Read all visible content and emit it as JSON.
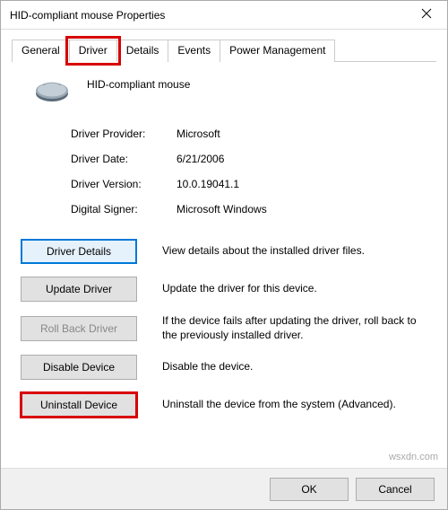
{
  "window": {
    "title": "HID-compliant mouse Properties"
  },
  "tabs": {
    "general": "General",
    "driver": "Driver",
    "details": "Details",
    "events": "Events",
    "power": "Power Management"
  },
  "device": {
    "name": "HID-compliant mouse"
  },
  "info": {
    "provider_label": "Driver Provider:",
    "provider_value": "Microsoft",
    "date_label": "Driver Date:",
    "date_value": "6/21/2006",
    "version_label": "Driver Version:",
    "version_value": "10.0.19041.1",
    "signer_label": "Digital Signer:",
    "signer_value": "Microsoft Windows"
  },
  "actions": {
    "details": {
      "label": "Driver Details",
      "desc": "View details about the installed driver files."
    },
    "update": {
      "label": "Update Driver",
      "desc": "Update the driver for this device."
    },
    "rollback": {
      "label": "Roll Back Driver",
      "desc": "If the device fails after updating the driver, roll back to the previously installed driver."
    },
    "disable": {
      "label": "Disable Device",
      "desc": "Disable the device."
    },
    "uninstall": {
      "label": "Uninstall Device",
      "desc": "Uninstall the device from the system (Advanced)."
    }
  },
  "footer": {
    "ok": "OK",
    "cancel": "Cancel"
  },
  "watermark": "wsxdn.com"
}
